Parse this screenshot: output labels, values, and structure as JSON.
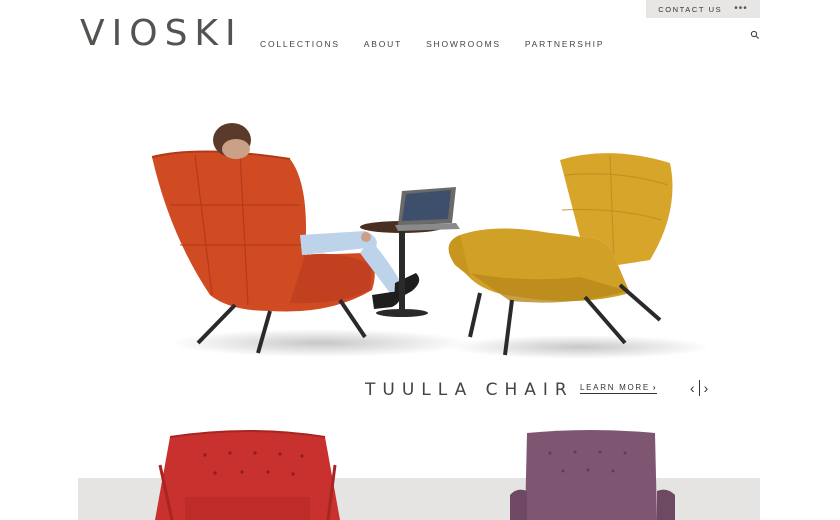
{
  "brand": {
    "logo_text": "VIOSKI"
  },
  "nav": {
    "items": [
      "COLLECTIONS",
      "ABOUT",
      "SHOWROOMS",
      "PARTNERSHIP"
    ]
  },
  "utility": {
    "contact_label": "CONTACT US",
    "more_glyph": "•••"
  },
  "hero": {
    "caption_title": "TUULLA CHAIR",
    "learn_more_label": "LEARN MORE",
    "prev_glyph": "‹",
    "next_glyph": "›"
  },
  "colors": {
    "accent_grey_bar": "#e8e6e4",
    "logo": "#55534f",
    "orange_chair": "#d04a22",
    "mustard_chair": "#d8a52b",
    "red_chair": "#c8312e",
    "purple_chair": "#7f5672"
  },
  "icons": [
    "search-icon",
    "more-dots-icon",
    "chevron-right-icon",
    "prev-arrow-icon",
    "next-arrow-icon"
  ]
}
